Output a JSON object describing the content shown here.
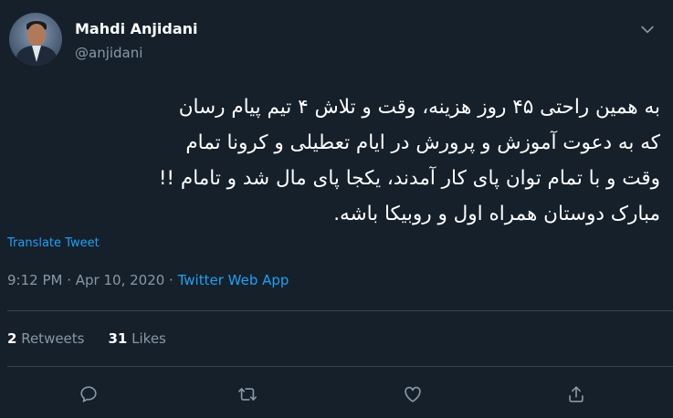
{
  "author": {
    "name": "Mahdi Anjidani",
    "handle": "@anjidani"
  },
  "tweet": {
    "lines": [
      "به همین راحتی ۴۵ روز هزینه، وقت و تلاش ۴ تیم پیام رسان",
      "که به دعوت آموزش و پرورش در ایام تعطیلی و کرونا تمام",
      "وقت و با تمام توان پای کار آمدند، یکجا پای مال شد و تامام !!",
      "مبارک دوستان همراه اول و روبیکا باشه."
    ],
    "translate_label": "Translate Tweet",
    "time": "9:12 PM",
    "separator1": " · ",
    "date": "Apr 10, 2020",
    "separator2": " · ",
    "app": "Twitter Web App"
  },
  "stats": {
    "retweets_count": "2",
    "retweets_label": " Retweets",
    "likes_count": "31",
    "likes_label": " Likes"
  },
  "actions": [
    "reply-icon",
    "retweet-icon",
    "like-icon",
    "share-icon"
  ],
  "colors": {
    "background": "#15202b",
    "text": "#ffffff",
    "secondary": "#8899a6",
    "accent": "#1da1f2",
    "divider": "#38444d"
  }
}
